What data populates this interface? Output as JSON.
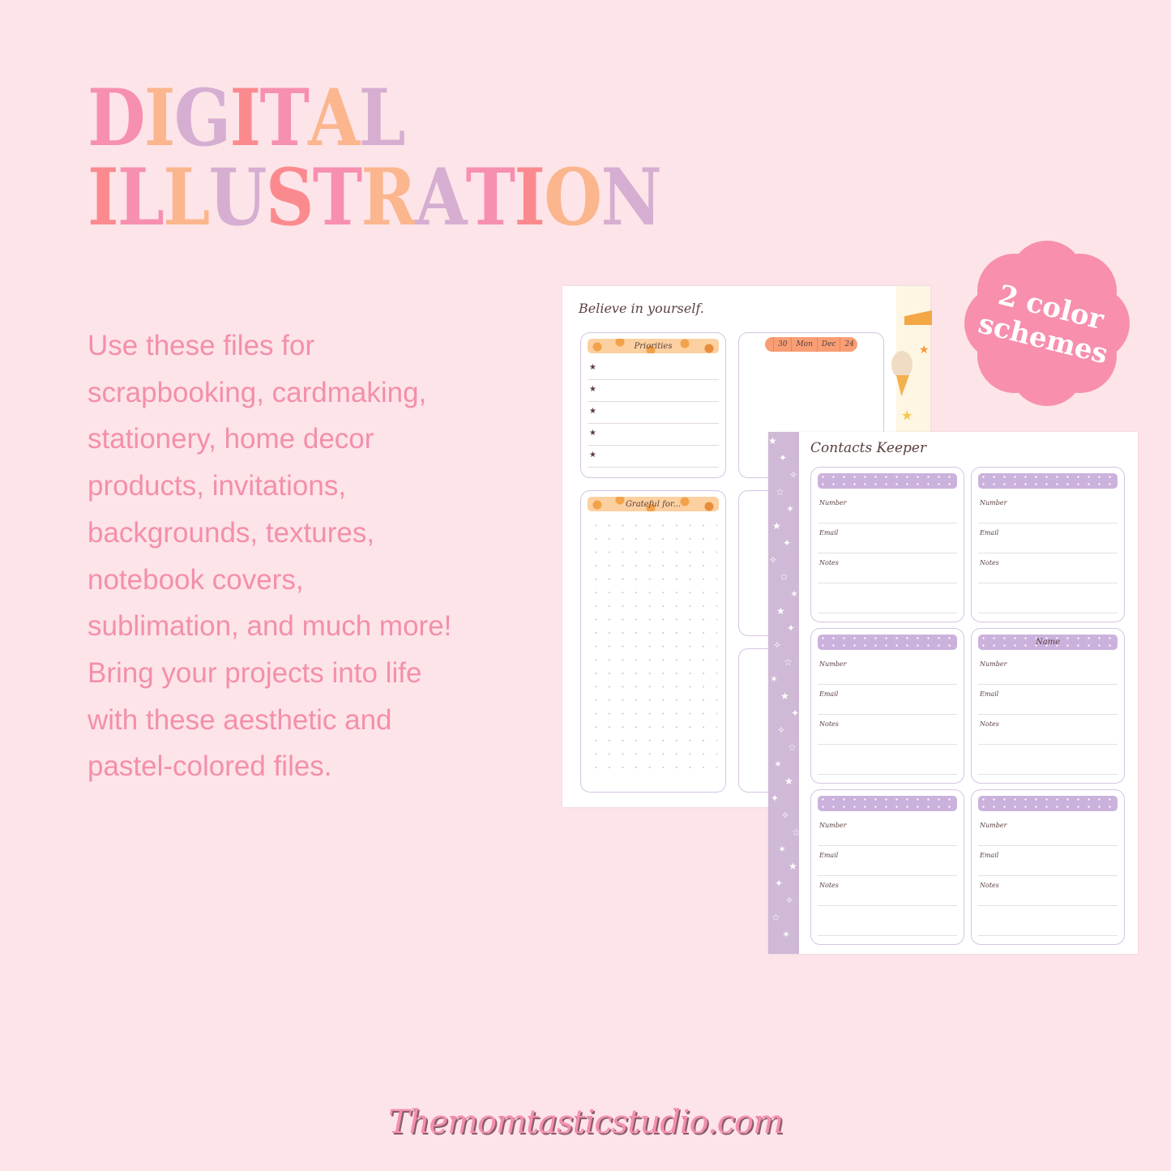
{
  "colors": {
    "background": "#fde4e8",
    "pink": "#f78fb0",
    "peach": "#fbb68e",
    "lavender": "#d6aed2",
    "coral": "#fb8a8e",
    "badge": "#f78fad",
    "body_text": "#f38fac"
  },
  "title": {
    "line1": [
      {
        "ch": "D",
        "color": "#f78fb0"
      },
      {
        "ch": "I",
        "color": "#fbb68e"
      },
      {
        "ch": "G",
        "color": "#d6aed2"
      },
      {
        "ch": "I",
        "color": "#fb8a8e"
      },
      {
        "ch": "T",
        "color": "#f78fb0"
      },
      {
        "ch": "A",
        "color": "#fbb68e"
      },
      {
        "ch": "L",
        "color": "#d6aed2"
      }
    ],
    "line2": [
      {
        "ch": "I",
        "color": "#fb8a8e"
      },
      {
        "ch": "L",
        "color": "#f78fb0"
      },
      {
        "ch": "L",
        "color": "#fbb68e"
      },
      {
        "ch": "U",
        "color": "#d6aed2"
      },
      {
        "ch": "S",
        "color": "#fb8a8e"
      },
      {
        "ch": "T",
        "color": "#f78fb0"
      },
      {
        "ch": "R",
        "color": "#fbb68e"
      },
      {
        "ch": "A",
        "color": "#d6aed2"
      },
      {
        "ch": "T",
        "color": "#f78fb0"
      },
      {
        "ch": "I",
        "color": "#fb8a8e"
      },
      {
        "ch": "O",
        "color": "#fbb68e"
      },
      {
        "ch": "N",
        "color": "#d6aed2"
      }
    ]
  },
  "description": {
    "lines": [
      "Use these files for",
      "scrapbooking, cardmaking,",
      "stationery, home decor",
      "products, invitations,",
      "backgrounds, textures,",
      "notebook covers,",
      "sublimation, and much more!",
      "Bring your projects into life",
      "with these aesthetic and",
      "pastel-colored files."
    ]
  },
  "badge": {
    "line1": "2 color",
    "line2": "schemes"
  },
  "planner_page": {
    "heading": "Believe in yourself.",
    "priorities_label": "Priorities",
    "priority_count": 5,
    "date_pill": {
      "day": "30",
      "weekday": "Mon",
      "month": "Dec",
      "year": "24"
    },
    "grateful_label": "Grateful for..."
  },
  "contacts_page": {
    "heading": "Contacts Keeper",
    "cards": [
      {
        "name": "",
        "fields": [
          "Number",
          "Email",
          "Notes"
        ]
      },
      {
        "name": "",
        "fields": [
          "Number",
          "Email",
          "Notes"
        ]
      },
      {
        "name": "",
        "fields": [
          "Number",
          "Email",
          "Notes"
        ]
      },
      {
        "name": "Name",
        "fields": [
          "Number",
          "Email",
          "Notes"
        ]
      },
      {
        "name": "",
        "fields": [
          "Number",
          "Email",
          "Notes"
        ]
      },
      {
        "name": "",
        "fields": [
          "Number",
          "Email",
          "Notes"
        ]
      }
    ]
  },
  "footer": {
    "website": "Themomtasticstudio.com"
  }
}
